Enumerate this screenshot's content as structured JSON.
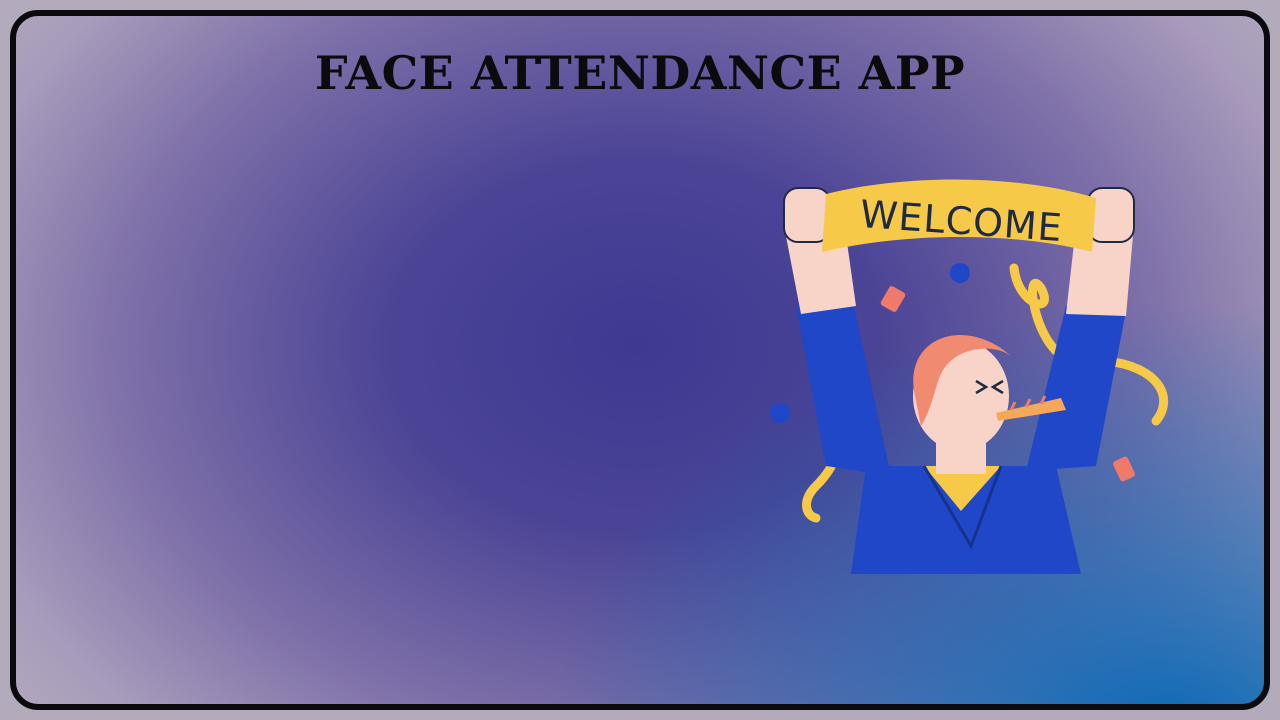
{
  "app": {
    "title": "FACE ATTENDANCE APP"
  },
  "illustration": {
    "banner_text": "WELCOME",
    "name": "welcome-celebration-illustration"
  },
  "colors": {
    "frame": "#0b0b0d",
    "background_purple": "#4b4496",
    "background_blue": "#0a68b6",
    "banner_yellow": "#f6c948",
    "shirt_blue": "#1f47c8",
    "hair_salmon": "#f08a70",
    "skin": "#f8d3c8"
  }
}
